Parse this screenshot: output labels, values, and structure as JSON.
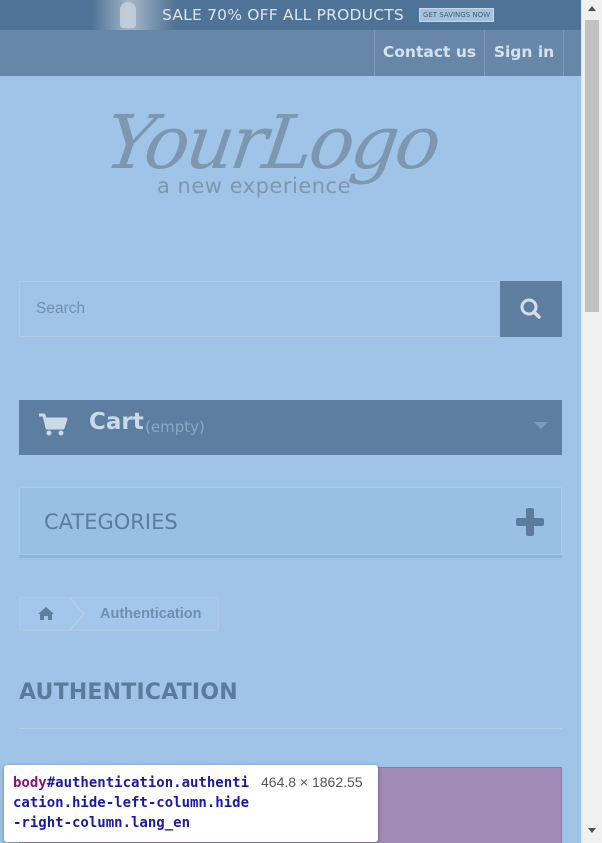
{
  "banner": {
    "sale_text": "SALE 70% OFF ALL PRODUCTS",
    "savings_button": "GET SAVINGS NOW"
  },
  "nav": {
    "contact_label": "Contact us",
    "signin_label": "Sign in"
  },
  "logo": {
    "name": "YourLogo",
    "tagline": "a new experience"
  },
  "search": {
    "placeholder": "Search",
    "value": "",
    "icon": "search-icon"
  },
  "cart": {
    "label": "Cart",
    "status": "(empty)",
    "icon": "cart-icon"
  },
  "categories": {
    "title": "CATEGORIES",
    "icon": "plus-icon"
  },
  "breadcrumb": {
    "home_icon": "home-icon",
    "current": "Authentication"
  },
  "page": {
    "heading": "AUTHENTICATION"
  },
  "devtools_tooltip": {
    "tag": "body",
    "selector": "#authentication.authentication.hide-left-column.hide-right-column.lang_en",
    "dimensions": "464.8 × 1862.55"
  },
  "colors": {
    "page_bg": "#9fc4e8",
    "nav_bg": "#6787a8",
    "accent_dark": "#5b7ea1",
    "highlight_box": "#9f8bb3"
  }
}
